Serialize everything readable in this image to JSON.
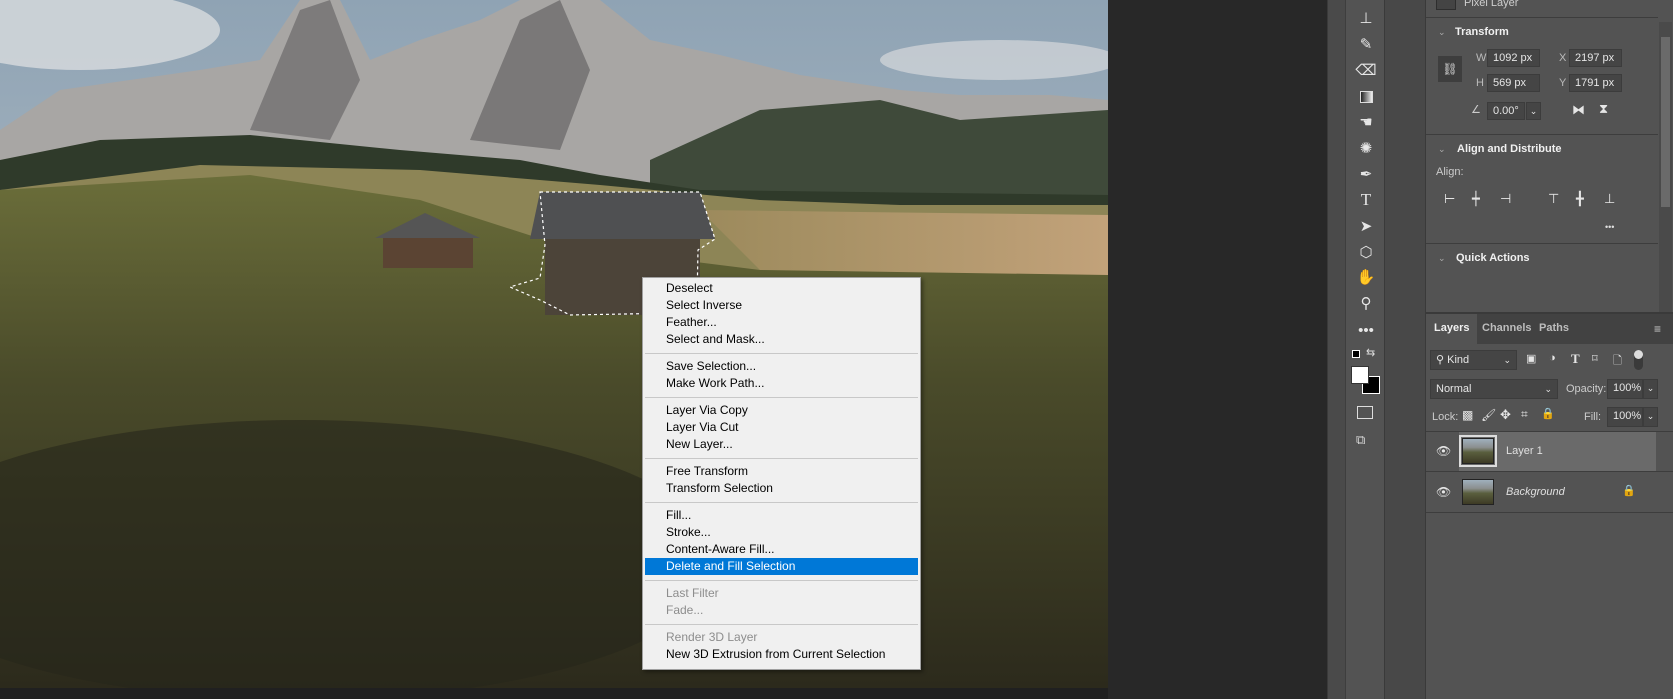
{
  "context_menu": {
    "groups": [
      [
        {
          "label": "Deselect",
          "enabled": true
        },
        {
          "label": "Select Inverse",
          "enabled": true
        },
        {
          "label": "Feather...",
          "enabled": true
        },
        {
          "label": "Select and Mask...",
          "enabled": true
        }
      ],
      [
        {
          "label": "Save Selection...",
          "enabled": true
        },
        {
          "label": "Make Work Path...",
          "enabled": true
        }
      ],
      [
        {
          "label": "Layer Via Copy",
          "enabled": true
        },
        {
          "label": "Layer Via Cut",
          "enabled": true
        },
        {
          "label": "New Layer...",
          "enabled": true
        }
      ],
      [
        {
          "label": "Free Transform",
          "enabled": true
        },
        {
          "label": "Transform Selection",
          "enabled": true
        }
      ],
      [
        {
          "label": "Fill...",
          "enabled": true
        },
        {
          "label": "Stroke...",
          "enabled": true
        },
        {
          "label": "Content-Aware Fill...",
          "enabled": true
        },
        {
          "label": "Delete and Fill Selection",
          "enabled": true,
          "highlighted": true
        }
      ],
      [
        {
          "label": "Last Filter",
          "enabled": false
        },
        {
          "label": "Fade...",
          "enabled": false
        }
      ],
      [
        {
          "label": "Render 3D Layer",
          "enabled": false
        },
        {
          "label": "New 3D Extrusion from Current Selection",
          "enabled": true
        }
      ]
    ],
    "highlight_color": "#0078d7"
  },
  "toolbar": {
    "tools": [
      "clone-stamp",
      "history-brush",
      "eraser",
      "gradient",
      "smudge",
      "sponge",
      "pen",
      "type",
      "path-selection",
      "shape",
      "hand",
      "zoom",
      "more"
    ],
    "foreground_color": "#ffffff",
    "background_color": "#000000"
  },
  "properties": {
    "layer_kind": "Pixel Layer",
    "transform": {
      "title": "Transform",
      "w_label": "W",
      "w": "1092 px",
      "h_label": "H",
      "h": "569 px",
      "x_label": "X",
      "x": "2197 px",
      "y_label": "Y",
      "y": "1791 px",
      "angle": "0.00°"
    },
    "align": {
      "title": "Align and Distribute",
      "label": "Align:",
      "more": "•••"
    },
    "quick_actions": {
      "title": "Quick Actions"
    }
  },
  "layers_panel": {
    "tabs": [
      "Layers",
      "Channels",
      "Paths"
    ],
    "active_tab": "Layers",
    "filter": "Kind",
    "blend_mode": "Normal",
    "opacity_label": "Opacity:",
    "opacity": "100%",
    "lock_label": "Lock:",
    "fill_label": "Fill:",
    "fill": "100%",
    "layers": [
      {
        "name": "Layer 1",
        "visible": true,
        "selected": true,
        "locked": false
      },
      {
        "name": "Background",
        "visible": true,
        "selected": false,
        "locked": true
      }
    ]
  }
}
